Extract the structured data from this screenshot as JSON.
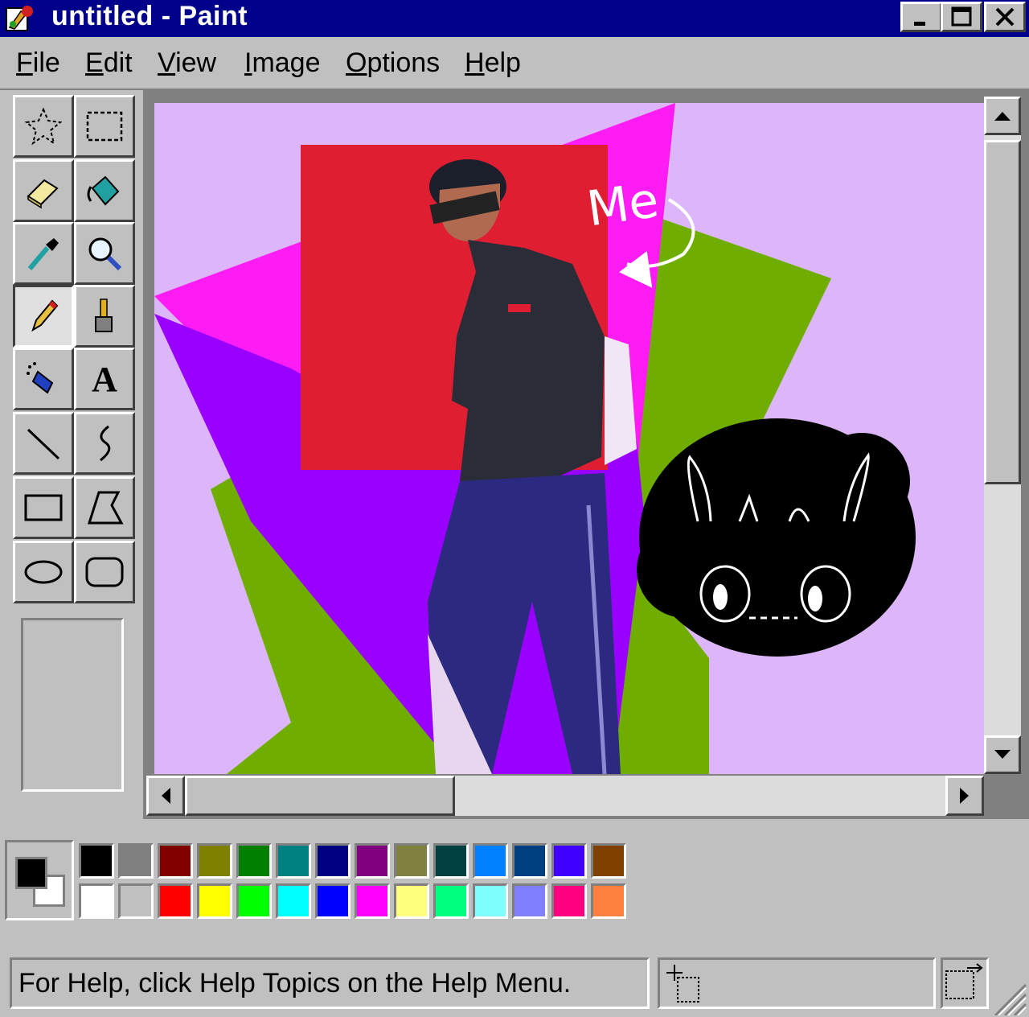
{
  "window": {
    "title": "untitled - Paint",
    "app_icon": "paint-icon"
  },
  "menu": [
    "File",
    "Edit",
    "View",
    "Image",
    "Options",
    "Help"
  ],
  "menu_accelerators": [
    "F",
    "E",
    "V",
    "I",
    "O",
    "H"
  ],
  "tools": [
    {
      "name": "free-form-select-tool",
      "icon": "star-select-icon"
    },
    {
      "name": "select-tool",
      "icon": "rect-select-icon"
    },
    {
      "name": "eraser-tool",
      "icon": "eraser-icon"
    },
    {
      "name": "fill-tool",
      "icon": "paint-bucket-icon"
    },
    {
      "name": "pick-color-tool",
      "icon": "eyedropper-icon"
    },
    {
      "name": "magnifier-tool",
      "icon": "magnifier-icon"
    },
    {
      "name": "pencil-tool",
      "icon": "pencil-icon",
      "active": true
    },
    {
      "name": "brush-tool",
      "icon": "brush-icon"
    },
    {
      "name": "airbrush-tool",
      "icon": "airbrush-icon"
    },
    {
      "name": "text-tool",
      "icon": "text-icon",
      "label": "A"
    },
    {
      "name": "line-tool",
      "icon": "line-icon"
    },
    {
      "name": "curve-tool",
      "icon": "curve-icon"
    },
    {
      "name": "rectangle-tool",
      "icon": "rectangle-icon"
    },
    {
      "name": "polygon-tool",
      "icon": "polygon-icon"
    },
    {
      "name": "ellipse-tool",
      "icon": "ellipse-icon"
    },
    {
      "name": "rounded-rectangle-tool",
      "icon": "rounded-rectangle-icon"
    }
  ],
  "canvas": {
    "annotation": "Me",
    "background": "#dcb6f8",
    "colors": [
      "#ff1cf4",
      "#9a00ff",
      "#6fae00",
      "#e01e32",
      "#000000"
    ]
  },
  "palette": {
    "foreground": "#000000",
    "background": "#ffffff",
    "top_row": [
      "#000000",
      "#808080",
      "#800000",
      "#808000",
      "#008000",
      "#008080",
      "#000080",
      "#800080",
      "#808040",
      "#004040",
      "#0080ff",
      "#004080",
      "#4000ff",
      "#804000"
    ],
    "bottom_row": [
      "#ffffff",
      "#c0c0c0",
      "#ff0000",
      "#ffff00",
      "#00ff00",
      "#00ffff",
      "#0000ff",
      "#ff00ff",
      "#ffff80",
      "#00ff80",
      "#80ffff",
      "#8080ff",
      "#ff0080",
      "#ff8040"
    ]
  },
  "status": {
    "help_text": "For Help, click Help Topics on the Help Menu."
  }
}
